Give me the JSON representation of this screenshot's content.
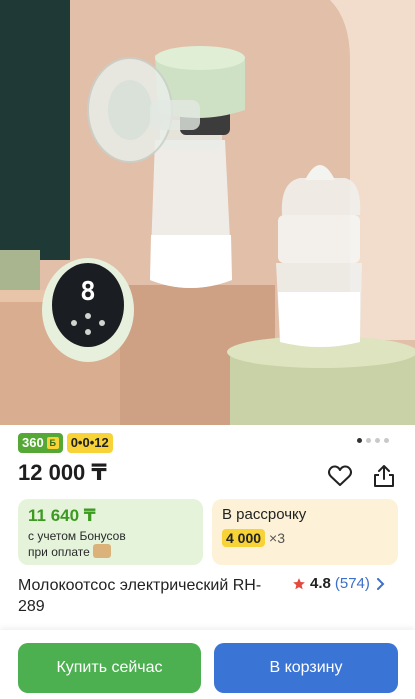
{
  "badges": {
    "bonus_label": "360",
    "bonus_mini": "Б",
    "installment_label": "0•0•12"
  },
  "gallery": {
    "dots": 4,
    "active": 0
  },
  "price": "12 000 ₸",
  "bonus_card": {
    "amount": "11 640 ₸",
    "note_line1": "с учетом Бонусов",
    "note_line2": "при оплате"
  },
  "installment_card": {
    "title": "В рассрочку",
    "monthly": "4 000",
    "multiplier": "×3"
  },
  "product": {
    "title": "Молокоотсос электрический RH-289",
    "rating": "4.8",
    "reviews": "(574)",
    "device_display": "8"
  },
  "actions": {
    "buy_now": "Купить сейчас",
    "add_to_cart": "В корзину"
  },
  "colors": {
    "accent_green": "#4caf50",
    "accent_blue": "#3a74d4",
    "bonus_green": "#55a836",
    "installment_yellow": "#f7d338",
    "star": "#e2493f"
  }
}
